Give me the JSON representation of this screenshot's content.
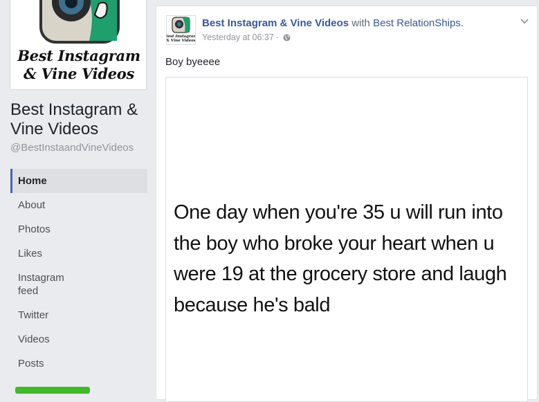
{
  "page": {
    "logo_line1": "Best Instagram",
    "logo_line2": "& Vine Videos",
    "name": "Best Instagram & Vine Videos",
    "handle": "@BestInstaandVineVideos"
  },
  "nav": {
    "items": [
      {
        "label": "Home",
        "active": true
      },
      {
        "label": "About"
      },
      {
        "label": "Photos"
      },
      {
        "label": "Likes"
      },
      {
        "label": "Instagram\nfeed"
      },
      {
        "label": "Twitter"
      },
      {
        "label": "Videos"
      },
      {
        "label": "Posts"
      }
    ]
  },
  "post": {
    "author": "Best Instagram & Vine Videos",
    "with": "with",
    "tagged": "Best RelationShips.",
    "timestamp": "Yesterday at 06:37",
    "separator": "·",
    "privacy_icon": "globe-icon",
    "menu_icon": "chevron-down-icon",
    "text": "Boy byeeee",
    "image_text": "One day when you're 35 u will run into the boy who broke your heart when u were 19 at the grocery store and laugh because he's bald"
  },
  "colors": {
    "link": "#365899",
    "accent": "#4267b2",
    "background": "#e9ebee",
    "like_button": "#42b72a"
  }
}
